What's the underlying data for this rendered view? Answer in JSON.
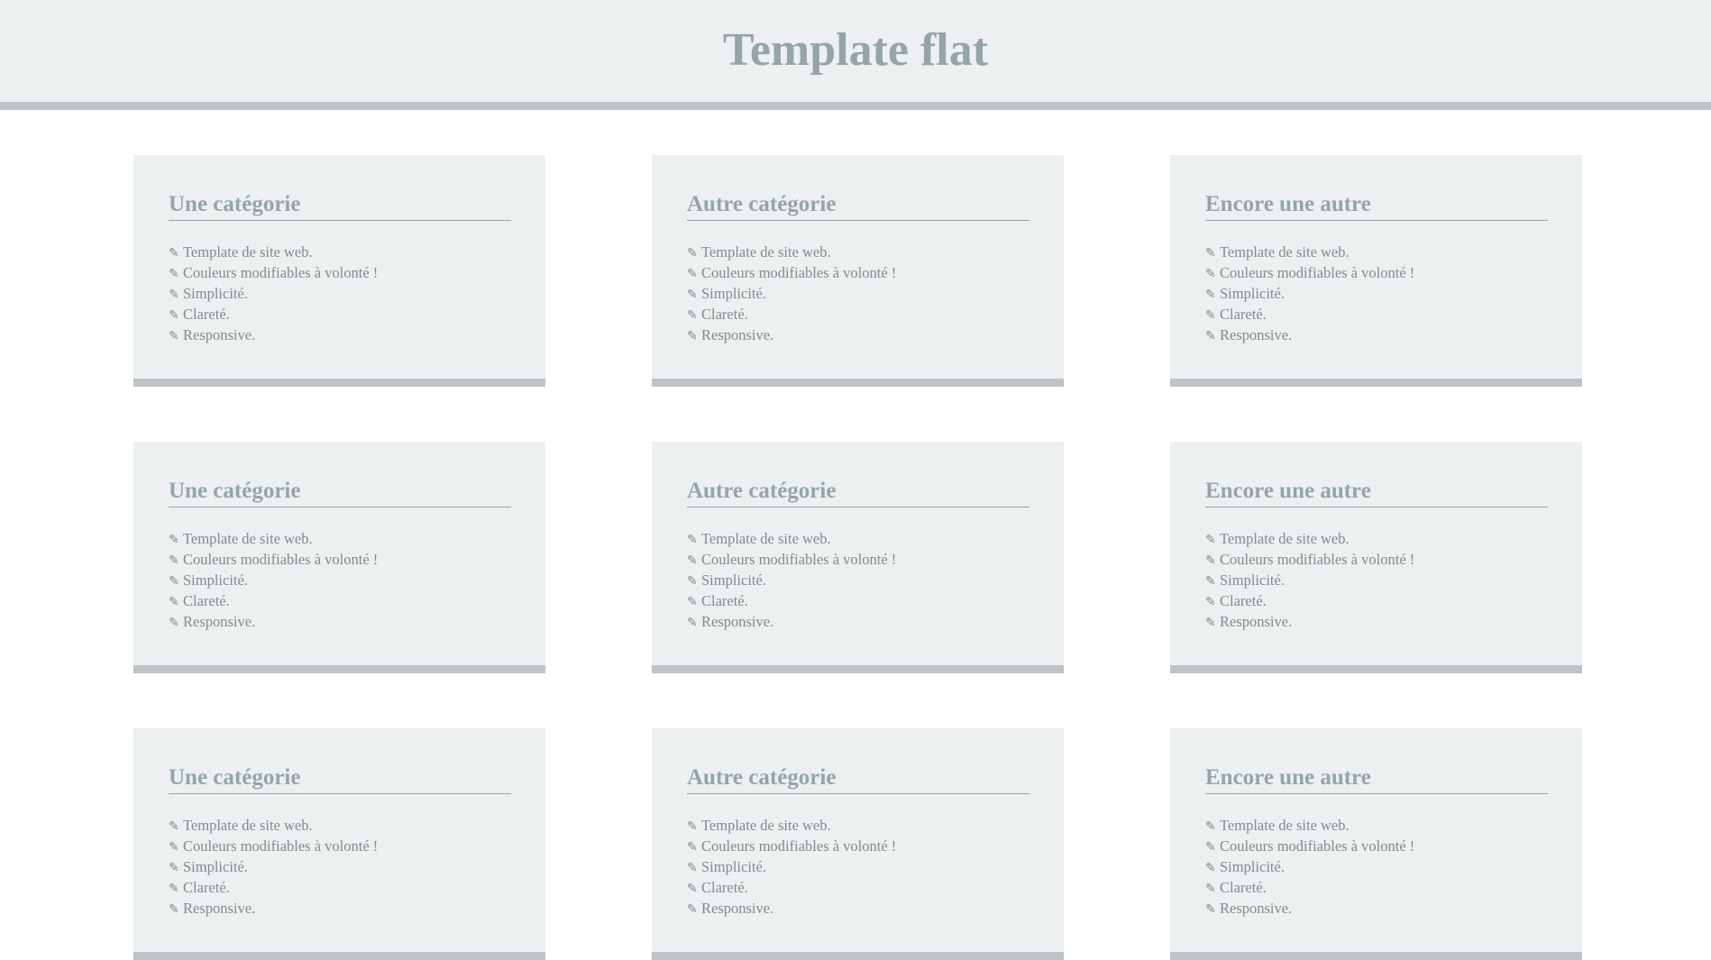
{
  "header": {
    "title": "Template flat"
  },
  "cards": [
    {
      "title": "Une catégorie",
      "items": [
        "Template de site web.",
        "Couleurs modifiables à volonté !",
        "Simplicité.",
        "Clareté.",
        "Responsive."
      ]
    },
    {
      "title": "Autre catégorie",
      "items": [
        "Template de site web.",
        "Couleurs modifiables à volonté !",
        "Simplicité.",
        "Clareté.",
        "Responsive."
      ]
    },
    {
      "title": "Encore une autre",
      "items": [
        "Template de site web.",
        "Couleurs modifiables à volonté !",
        "Simplicité.",
        "Clareté.",
        "Responsive."
      ]
    },
    {
      "title": "Une catégorie",
      "items": [
        "Template de site web.",
        "Couleurs modifiables à volonté !",
        "Simplicité.",
        "Clareté.",
        "Responsive."
      ]
    },
    {
      "title": "Autre catégorie",
      "items": [
        "Template de site web.",
        "Couleurs modifiables à volonté !",
        "Simplicité.",
        "Clareté.",
        "Responsive."
      ]
    },
    {
      "title": "Encore une autre",
      "items": [
        "Template de site web.",
        "Couleurs modifiables à volonté !",
        "Simplicité.",
        "Clareté.",
        "Responsive."
      ]
    },
    {
      "title": "Une catégorie",
      "items": [
        "Template de site web.",
        "Couleurs modifiables à volonté !",
        "Simplicité.",
        "Clareté.",
        "Responsive."
      ]
    },
    {
      "title": "Autre catégorie",
      "items": [
        "Template de site web.",
        "Couleurs modifiables à volonté !",
        "Simplicité.",
        "Clareté.",
        "Responsive."
      ]
    },
    {
      "title": "Encore une autre",
      "items": [
        "Template de site web.",
        "Couleurs modifiables à volonté !",
        "Simplicité.",
        "Clareté.",
        "Responsive."
      ]
    }
  ],
  "icons": {
    "list_bullet": "pencil-icon"
  },
  "colors": {
    "panel_background": "#ecf0f1",
    "panel_border": "#bdc3c7",
    "heading_text": "#95a5a6",
    "body_text": "#7f8c8d"
  }
}
